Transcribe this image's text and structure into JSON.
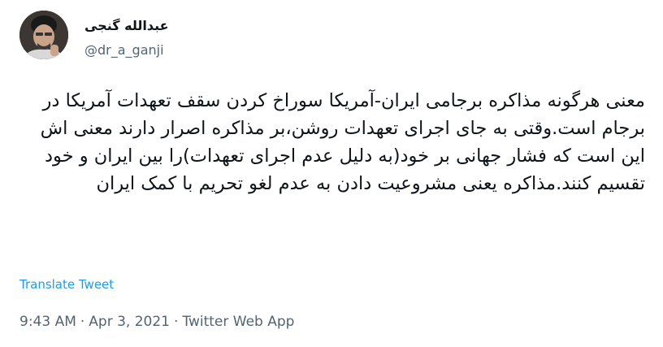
{
  "tweet": {
    "author": {
      "display_name": "عبدالله گنجی",
      "handle": "@dr_a_ganji"
    },
    "text": "معنی هرگونه مذاکره برجامی ایران-آمریکا سوراخ کردن سقف تعهدات آمریکا در برجام است.وقتی به جای اجرای تعهدات روشن،بر مذاکره اصرار دارند معنی اش این است که فشار جهانی بر خود(به دلیل عدم اجرای تعهدات)را بین ایران و خود تقسیم کنند.مذاکره یعنی مشروعیت دادن به عدم لغو تحریم با کمک ایران",
    "translate_label": "Translate Tweet",
    "time": "9:43 AM",
    "separator": "·",
    "date": "Apr 3, 2021",
    "source": "Twitter Web App"
  },
  "colors": {
    "text": "#0f1419",
    "secondary": "#536471",
    "link": "#1d9bf0"
  }
}
